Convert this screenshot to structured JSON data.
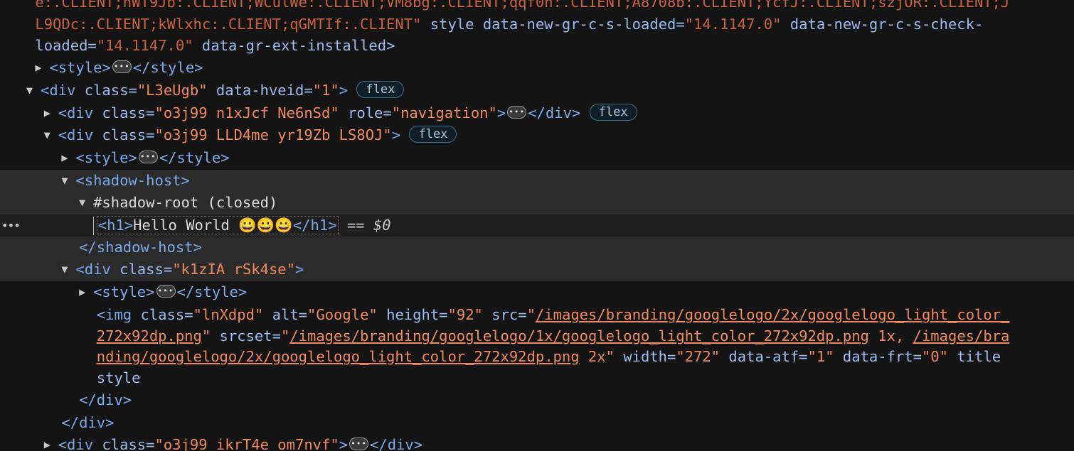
{
  "lines": {
    "l0": "e:.CLIENT;hWT9Jb:.CLIENT;WCulWe:.CLIENT;VM8bg:.CLIENT;qqf0n:.CLIENT;A8708b:.CLIENT;YcfJ:.CLIENT;szjOR:.CLIENT;J",
    "l1_val": "L9QDc:.CLIENT;kWlxhc:.CLIENT;qGMTIf:.CLIENT\"",
    "l1_attr1": " style data-new-gr-c-s-loaded=",
    "l1_val2": "\"14.1147.0\"",
    "l1_attr2": " data-new-gr-c-s-check-",
    "l2_attr": "loaded=",
    "l2_val": "\"14.1147.0\"",
    "l2_attr2": " data-gr-ext-installed",
    "l2_close": ">"
  },
  "nodes": {
    "style_open": "<style>",
    "style_close": "</style>",
    "div_open": "<div",
    "div_close": "</div>",
    "gt": ">",
    "class_eq": " class=",
    "div1_class": "\"L3eUgb\"",
    "div1_attr": " data-hveid=",
    "div1_val": "\"1\"",
    "div2_class": "\"o3j99 n1xJcf Ne6nSd\"",
    "div2_attr": " role=",
    "div2_val": "\"navigation\"",
    "div3_class": "\"o3j99 LLD4me yr19Zb LS8OJ\"",
    "shadow_host_open": "<shadow-host>",
    "shadow_root": "#shadow-root (closed)",
    "h1_open": "<h1>",
    "h1_text": "Hello World 😀😀😀",
    "h1_close": "</h1>",
    "eq_marker": " == ",
    "dollar_marker": "$0",
    "shadow_host_close": "</shadow-host>",
    "div4_class": "\"k1zIA rSk4se\"",
    "img_open": "<img",
    "img_class": "\"lnXdpd\"",
    "img_alt_attr": " alt=",
    "img_alt_val": "\"Google\"",
    "img_height_attr": " height=",
    "img_height_val": "\"92\"",
    "img_src_attr": " src=",
    "img_src_q": "\"",
    "img_src_link1": "/images/branding/googlelogo/2x/googlelogo_light_color_",
    "img_src_link2": "272x92dp.png",
    "img_srcset_attr": " srcset=",
    "img_srcset_link1": "/images/branding/googlelogo/1x/googlelogo_light_color_272x92dp.png",
    "img_srcset_1x": " 1x, ",
    "img_srcset_link2a": "/images/bra",
    "img_srcset_link2b": "nding/googlelogo/2x/googlelogo_light_color_272x92dp.png",
    "img_srcset_2x": " 2x\"",
    "img_width_attr": " width=",
    "img_width_val": "\"272\"",
    "img_atf_attr": " data-atf=",
    "img_atf_val": "\"1\"",
    "img_frt_attr": " data-frt=",
    "img_frt_val": "\"0\"",
    "img_title_attr": " title",
    "img_style_attr": "style",
    "div_last_class": "\"o3j99 ikrT4e om7nvf\""
  },
  "badges": {
    "flex": "flex"
  },
  "gutter": {
    "dots": "•••"
  },
  "colors": {
    "background": "#141414",
    "tag": "#7aa9e8",
    "attr_value": "#f08a5d",
    "hover_row": "#2b2b2b"
  }
}
